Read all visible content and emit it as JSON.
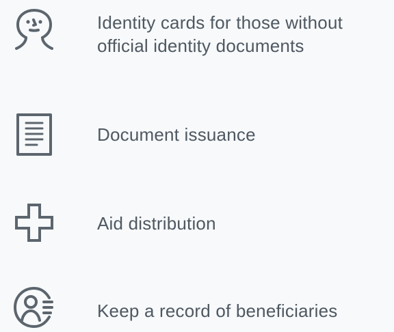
{
  "colors": {
    "background": "#f7f9fb",
    "text": "#4f5861",
    "icon": "#5c656d"
  },
  "features": [
    {
      "icon": "face-icon",
      "label_line_1": "Identity cards for those without",
      "label_line_2": "official identity documents"
    },
    {
      "icon": "document-icon",
      "label": "Document issuance"
    },
    {
      "icon": "plus-icon",
      "label": "Aid distribution"
    },
    {
      "icon": "beneficiary-record-icon",
      "label": "Keep a record of beneficiaries"
    }
  ]
}
